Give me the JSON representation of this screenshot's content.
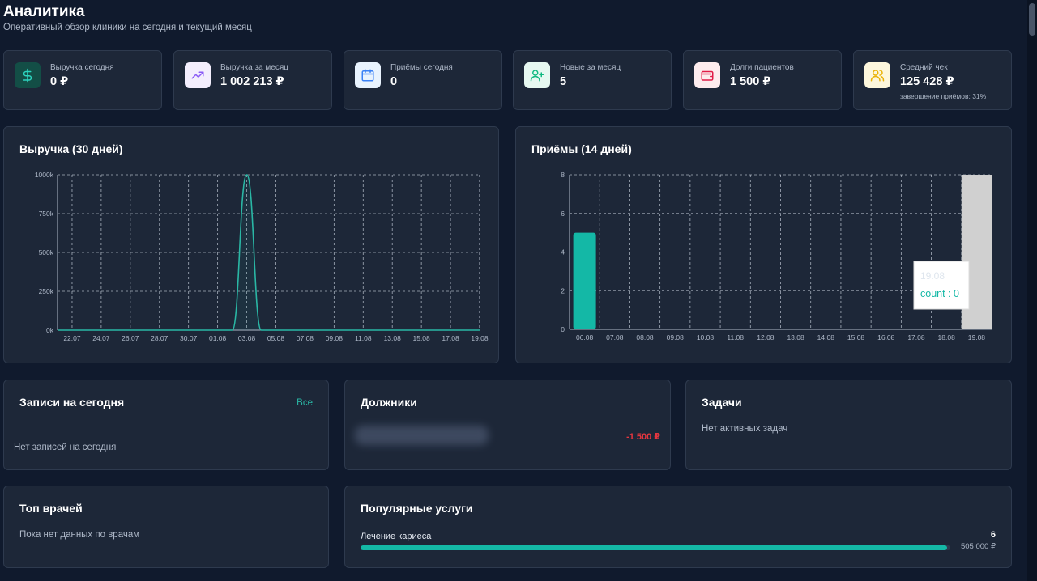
{
  "header": {
    "title": "Аналитика",
    "subtitle": "Оперативный обзор клиники на сегодня и текущий месяц"
  },
  "stats": [
    {
      "label": "Выручка сегодня",
      "value": "0 ₽",
      "icon": "dollar-icon",
      "icon_bg": "#134e46",
      "icon_color": "#2dd4bf"
    },
    {
      "label": "Выручка за месяц",
      "value": "1 002 213 ₽",
      "icon": "trend-up-icon",
      "icon_bg": "#f3eefd",
      "icon_color": "#8b5cf6"
    },
    {
      "label": "Приёмы сегодня",
      "value": "0",
      "icon": "calendar-icon",
      "icon_bg": "#e9f3fe",
      "icon_color": "#3b82f6"
    },
    {
      "label": "Новые за месяц",
      "value": "5",
      "icon": "user-plus-icon",
      "icon_bg": "#e6f8f1",
      "icon_color": "#10b981"
    },
    {
      "label": "Долги пациентов",
      "value": "1 500 ₽",
      "icon": "wallet-icon",
      "icon_bg": "#fdecee",
      "icon_color": "#e11d48"
    },
    {
      "label": "Средний чек",
      "value": "125 428 ₽",
      "sub": "завершение приёмов: 31%",
      "icon": "users-icon",
      "icon_bg": "#fdf7dd",
      "icon_color": "#eab308"
    }
  ],
  "revenue_card": {
    "title": "Выручка (30 дней)"
  },
  "appointments_card": {
    "title": "Приёмы (14 дней)"
  },
  "tooltip": {
    "date": "19.08",
    "text": "count : 0"
  },
  "chart_data": [
    {
      "type": "area",
      "title": "Выручка (30 дней)",
      "x": [
        "21.07",
        "22.07",
        "23.07",
        "24.07",
        "25.07",
        "26.07",
        "27.07",
        "28.07",
        "29.07",
        "30.07",
        "31.07",
        "01.08",
        "02.08",
        "03.08",
        "04.08",
        "05.08",
        "06.08",
        "07.08",
        "08.08",
        "09.08",
        "10.08",
        "11.08",
        "12.08",
        "13.08",
        "14.08",
        "15.08",
        "16.08",
        "17.08",
        "18.08",
        "19.08"
      ],
      "x_tick_labels": [
        "22.07",
        "24.07",
        "26.07",
        "28.07",
        "30.07",
        "01.08",
        "03.08",
        "05.08",
        "07.08",
        "09.08",
        "11.08",
        "13.08",
        "15.08",
        "17.08",
        "19.08"
      ],
      "values": [
        0,
        0,
        0,
        0,
        0,
        0,
        0,
        0,
        0,
        0,
        0,
        0,
        0,
        1000000,
        0,
        0,
        0,
        0,
        0,
        0,
        0,
        0,
        0,
        0,
        0,
        0,
        0,
        0,
        0,
        0
      ],
      "ylim": [
        0,
        1000000
      ],
      "y_ticks": [
        {
          "value": 0,
          "label": "0k"
        },
        {
          "value": 250000,
          "label": "250k"
        },
        {
          "value": 500000,
          "label": "500k"
        },
        {
          "value": 750000,
          "label": "750k"
        },
        {
          "value": 1000000,
          "label": "1000k"
        }
      ],
      "color": "#2ab7a5",
      "grid": true
    },
    {
      "type": "bar",
      "title": "Приёмы (14 дней)",
      "categories": [
        "06.08",
        "07.08",
        "08.08",
        "09.08",
        "10.08",
        "11.08",
        "12.08",
        "13.08",
        "14.08",
        "15.08",
        "16.08",
        "17.08",
        "18.08",
        "19.08"
      ],
      "values": [
        5,
        0,
        0,
        0,
        0,
        0,
        0,
        0,
        0,
        0,
        0,
        0,
        0,
        0
      ],
      "ylim": [
        0,
        8
      ],
      "y_ticks": [
        0,
        2,
        4,
        6,
        8
      ],
      "color": "#14b8a6",
      "highlight": "19.08",
      "grid": true
    }
  ],
  "today": {
    "title": "Записи на сегодня",
    "link": "Все",
    "empty": "Нет записей на сегодня"
  },
  "debtors": {
    "title": "Должники",
    "amount": "-1 500 ₽"
  },
  "tasks": {
    "title": "Задачи",
    "empty": "Нет активных задач"
  },
  "doctors": {
    "title": "Топ врачей",
    "empty": "Пока нет данных по врачам"
  },
  "services": {
    "title": "Популярные услуги",
    "items": [
      {
        "name": "Лечение кариеса",
        "count": "6",
        "amount": "505 000 ₽",
        "share": 0.995
      }
    ]
  }
}
